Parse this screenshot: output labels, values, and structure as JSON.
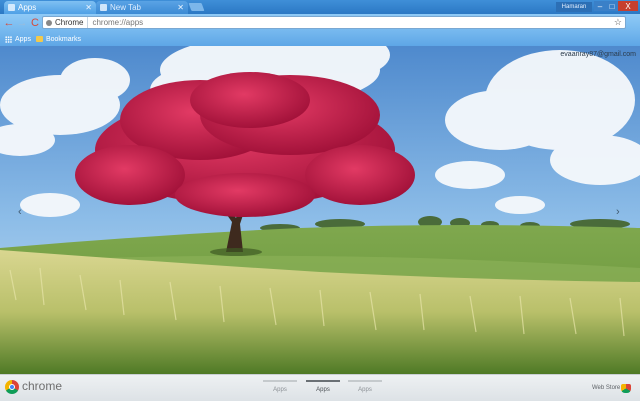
{
  "tabs": [
    {
      "title": "Apps",
      "active": true
    },
    {
      "title": "New Tab",
      "active": false
    }
  ],
  "window": {
    "user_label": "Hamaran",
    "minimize": "–",
    "maximize": "□",
    "close": "X"
  },
  "toolbar": {
    "back_icon": "←",
    "forward_icon": "→",
    "reload_icon": "C",
    "chip_label": "Chrome",
    "url": "chrome://apps",
    "star": "☆"
  },
  "bookmarks": {
    "apps_label": "Apps",
    "bookmarks_label": "Bookmarks"
  },
  "page": {
    "email": "evaanray87@gmail.com",
    "prev_arrow": "‹",
    "next_arrow": "›"
  },
  "bottom": {
    "brand": "chrome",
    "page_tabs": [
      "Apps",
      "Apps",
      "Apps"
    ],
    "active_page": 1,
    "webstore_label": "Web Store"
  },
  "colors": {
    "tab_strip": "#2b78c4",
    "toolbar": "#74b7ee",
    "close_button": "#c6402f",
    "tree_blossom": "#c81e4a"
  }
}
